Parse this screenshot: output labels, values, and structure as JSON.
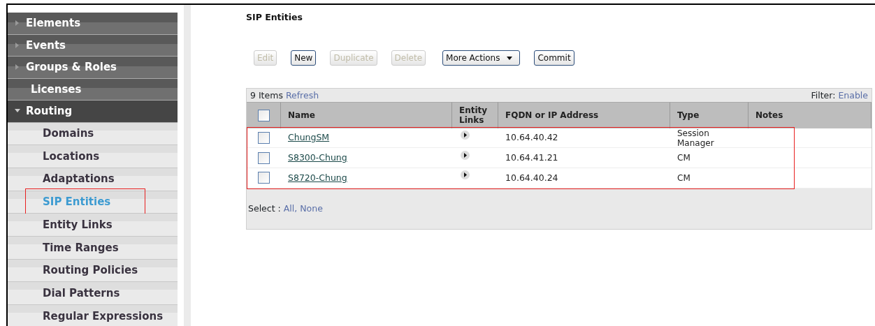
{
  "sidebar": {
    "items": [
      {
        "label": "Elements",
        "kind": "group",
        "expanded": false
      },
      {
        "label": "Events",
        "kind": "group",
        "expanded": false
      },
      {
        "label": "Groups & Roles",
        "kind": "group",
        "expanded": false
      },
      {
        "label": "Licenses",
        "kind": "link"
      },
      {
        "label": "Routing",
        "kind": "group",
        "expanded": true,
        "children": [
          {
            "label": "Domains",
            "selected": false,
            "highlighted": false
          },
          {
            "label": "Locations",
            "selected": false,
            "highlighted": false
          },
          {
            "label": "Adaptations",
            "selected": false,
            "highlighted": false
          },
          {
            "label": "SIP Entities",
            "selected": true,
            "highlighted": true
          },
          {
            "label": "Entity Links",
            "selected": false,
            "highlighted": false
          },
          {
            "label": "Time Ranges",
            "selected": false,
            "highlighted": false
          },
          {
            "label": "Routing Policies",
            "selected": false,
            "highlighted": false
          },
          {
            "label": "Dial Patterns",
            "selected": false,
            "highlighted": false
          },
          {
            "label": "Regular Expressions",
            "selected": false,
            "highlighted": false
          }
        ]
      }
    ]
  },
  "page_title": "SIP Entities",
  "toolbar": [
    {
      "label": "Edit",
      "kind": "button",
      "disabled": true
    },
    {
      "label": "New",
      "kind": "button",
      "disabled": false
    },
    {
      "label": "Duplicate",
      "kind": "button",
      "disabled": true
    },
    {
      "label": "Delete",
      "kind": "button",
      "disabled": true
    },
    {
      "label": "More Actions",
      "kind": "dropdown",
      "disabled": false
    },
    {
      "label": "Commit",
      "kind": "button",
      "disabled": false
    }
  ],
  "table": {
    "count": "9 Items",
    "refresh": "Refresh",
    "filter_label": "Filter:",
    "filter_link": "Enable",
    "columns": [
      "Name",
      "Entity Links",
      "FQDN or IP Address",
      "Type",
      "Notes"
    ],
    "rows_highlighted": true,
    "select_all_checked": false,
    "rows": [
      {
        "name": "ChungSM",
        "address": "10.64.40.42",
        "type": "Session Manager",
        "checked": false
      },
      {
        "name": "S8300-Chung",
        "address": "10.64.41.21",
        "type": "CM",
        "checked": false
      },
      {
        "name": "S8720-Chung",
        "address": "10.64.40.24",
        "type": "CM",
        "checked": false
      }
    ],
    "select_label": "Select :",
    "select_all": "All,",
    "select_none": "None"
  }
}
